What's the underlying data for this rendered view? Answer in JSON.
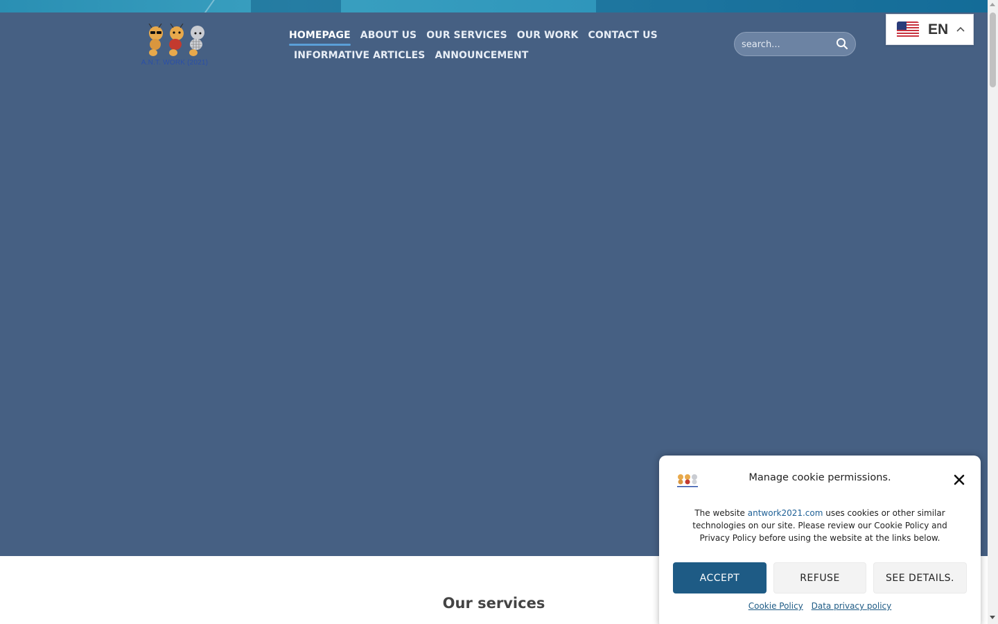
{
  "header": {
    "logo_text": "A.N.T. WORK (2021)",
    "nav": [
      {
        "label": "HOMEPAGE",
        "active": true
      },
      {
        "label": "ABOUT US"
      },
      {
        "label": "OUR SERVICES"
      },
      {
        "label": "OUR WORK"
      },
      {
        "label": "CONTACT US"
      },
      {
        "label": "INFORMATIVE ARTICLES"
      },
      {
        "label": "ANNOUNCEMENT"
      }
    ],
    "search": {
      "placeholder": "search...",
      "icon": "search-icon"
    },
    "language": {
      "code": "EN",
      "flag": "us-flag-icon",
      "chevron": "chevron-up-icon"
    }
  },
  "hero": {
    "background_color": "#466083"
  },
  "main": {
    "services_title": "Our services"
  },
  "cookie_dialog": {
    "title": "Manage cookie permissions.",
    "body_prefix": "The website ",
    "body_site": "antwork2021.com",
    "body_suffix": " uses cookies or other similar technologies on our site. Please review our Cookie Policy and Privacy Policy before using the website at the links below.",
    "buttons": {
      "accept": "ACCEPT",
      "refuse": "REFUSE",
      "details": "SEE DETAILS."
    },
    "links": {
      "cookie_policy": "Cookie Policy",
      "privacy_policy": "Data privacy policy"
    },
    "accent_color": "#1e5b85"
  }
}
